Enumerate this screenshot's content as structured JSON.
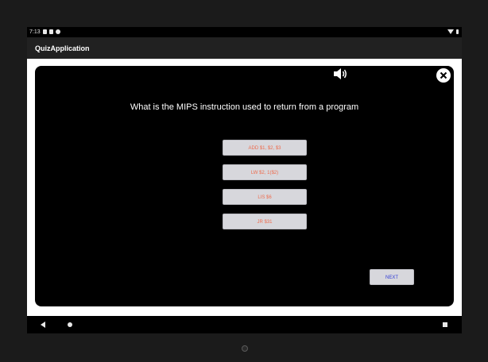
{
  "status_bar": {
    "time": "7:13",
    "left_icons": [
      "sim-icon",
      "settings-icon",
      "sync-icon"
    ],
    "right_icons": [
      "wifi-icon",
      "battery-icon"
    ]
  },
  "app_bar": {
    "title": "QuizApplication"
  },
  "quiz": {
    "question": "What is the MIPS instruction used to return from a program",
    "options": [
      "ADD $1, $2, $3",
      "LW $2, 1($2)",
      "LIS $6",
      "JR $31"
    ],
    "next_label": "NEXT",
    "sound_icon": "volume-icon",
    "close_icon": "close-icon"
  },
  "navigation": {
    "icons": [
      "back-icon",
      "home-icon",
      "recents-icon"
    ]
  },
  "colors": {
    "card_background": "#000000",
    "content_background": "#ffffff",
    "option_text": "#ee6b4d",
    "next_text": "#2f3bd6",
    "button_background": "#d7d7dc",
    "app_bar": "#212121"
  }
}
